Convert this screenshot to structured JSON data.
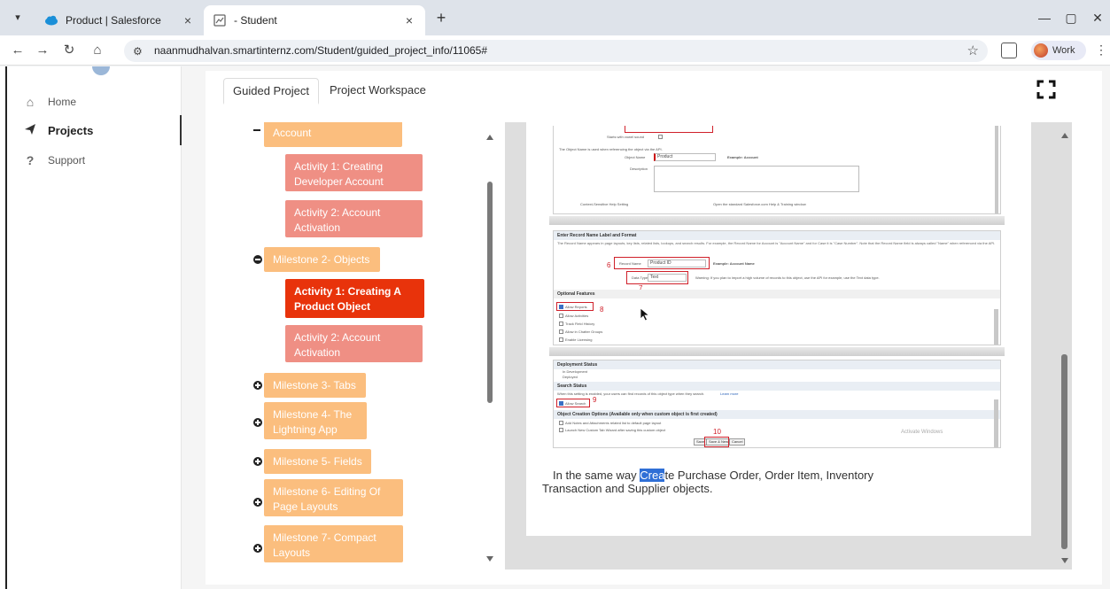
{
  "browser": {
    "tabs": [
      {
        "title": "Product | Salesforce",
        "active": false
      },
      {
        "title": "- Student",
        "active": true
      }
    ],
    "url": "naanmudhalvan.smartinternz.com/Student/guided_project_info/11065#",
    "profile_label": "Work",
    "icons": [
      "tab-list-icon",
      "salesforce-cloud-icon",
      "page-favicon-icon",
      "close-icon",
      "new-tab-icon",
      "minimize-icon",
      "restore-icon",
      "back-icon",
      "forward-icon",
      "reload-icon",
      "home-icon",
      "site-settings-icon",
      "bookmark-star-icon",
      "extensions-icon",
      "kebab-menu-icon"
    ]
  },
  "sidebar": {
    "items": [
      {
        "label": "Home",
        "icon": "home-icon",
        "active": false
      },
      {
        "label": "Projects",
        "icon": "paper-plane-icon",
        "active": true
      },
      {
        "label": "Support",
        "icon": "question-icon",
        "active": false
      }
    ]
  },
  "project_tabs": [
    {
      "label": "Guided Project",
      "active": true
    },
    {
      "label": "Project Workspace",
      "active": false
    }
  ],
  "tree": {
    "clipped_top": "Account",
    "items": [
      {
        "kind": "activity",
        "label_lines": [
          "Activity 1: Creating",
          "Developer Account"
        ]
      },
      {
        "kind": "activity",
        "label_lines": [
          "Activity 2: Account",
          "Activation"
        ]
      },
      {
        "kind": "milestone",
        "label_lines": [
          "Milestone 2- Objects"
        ],
        "expanded": true
      },
      {
        "kind": "activity",
        "label_lines": [
          "Activity 1: Creating A",
          "Product Object"
        ],
        "current": true
      },
      {
        "kind": "activity",
        "label_lines": [
          "Activity 2: Account",
          "Activation"
        ]
      },
      {
        "kind": "milestone",
        "label_lines": [
          "Milestone 3- Tabs"
        ],
        "expanded": false
      },
      {
        "kind": "milestone",
        "label_lines": [
          "Milestone 4- The",
          "Lightning App"
        ],
        "expanded": false
      },
      {
        "kind": "milestone",
        "label_lines": [
          "Milestone 5- Fields"
        ],
        "expanded": false
      },
      {
        "kind": "milestone",
        "label_lines": [
          "Milestone 6- Editing Of",
          "Page Layouts"
        ],
        "expanded": false
      },
      {
        "kind": "milestone",
        "label_lines": [
          "Milestone 7- Compact",
          "Layouts"
        ],
        "expanded": false
      }
    ]
  },
  "document": {
    "shot1": {
      "label_starts": "Starts with vowel sound",
      "intro": "The Object Name is used when referencing the object via the API.",
      "object_name_label": "Object Name",
      "object_name_value": "Product",
      "example": "Example:  Account",
      "description_label": "Description",
      "help_label": "Context-Sensitive Help Setting",
      "help_option": "Open the standard Salesforce.com Help & Training window"
    },
    "shot2": {
      "header": "Enter Record Name Label and Format",
      "intro": "The Record Name appears in page layouts, key lists, related lists, lookups, and search results. For example, the Record Name for Account is \"Account Name\" and for Case it is \"Case Number\". Note that the Record Name field is always called \"Name\" when referenced via the API.",
      "record_name_label": "Record Name",
      "record_name_value": "Product ID",
      "example": "Example:  Account Name",
      "data_type_label": "Data Type",
      "data_type_value": "Text",
      "warning": "Warning: If you plan to import a high volume of records to this object, use the API for example, use the Text data type.",
      "optional_header": "Optional Features",
      "features": [
        {
          "label": "Allow Reports",
          "checked": true
        },
        {
          "label": "Allow Activities",
          "checked": false
        },
        {
          "label": "Track Field History",
          "checked": false
        },
        {
          "label": "Allow in Chatter Groups",
          "checked": false
        },
        {
          "label": "Enable Licensing",
          "checked": false
        }
      ],
      "numbers": [
        "6",
        "7",
        "8"
      ]
    },
    "shot3": {
      "deploy_header": "Deployment Status",
      "deploy_options": [
        "In Development",
        "Deployed"
      ],
      "search_header": "Search Status",
      "search_intro": "When this setting is enabled, your users can find records of this object type when they search.",
      "search_link": "Learn more",
      "allow_search": "Allow Search",
      "creation_header": "Object Creation Options (Available only when custom object is first created)",
      "creation_options": [
        "Add Notes and Attachments related list to default page layout",
        "Launch New Custom Tab Wizard after saving this custom object"
      ],
      "activate_watermark": "Activate Windows",
      "buttons": [
        "Save",
        "Save & New",
        "Cancel"
      ],
      "numbers": [
        "9",
        "10"
      ]
    },
    "paragraph": {
      "before": "In the same way ",
      "highlight": "Crea",
      "after": "te Purchase Order, Order Item, Inventory",
      "line2": "Transaction and Supplier objects."
    }
  },
  "colors": {
    "milestone": "#fbbe7e",
    "activity": "#ef8f84",
    "current_activity": "#e8330b",
    "annotation_red": "#d0202a",
    "text_highlight": "#2f6fd6"
  }
}
